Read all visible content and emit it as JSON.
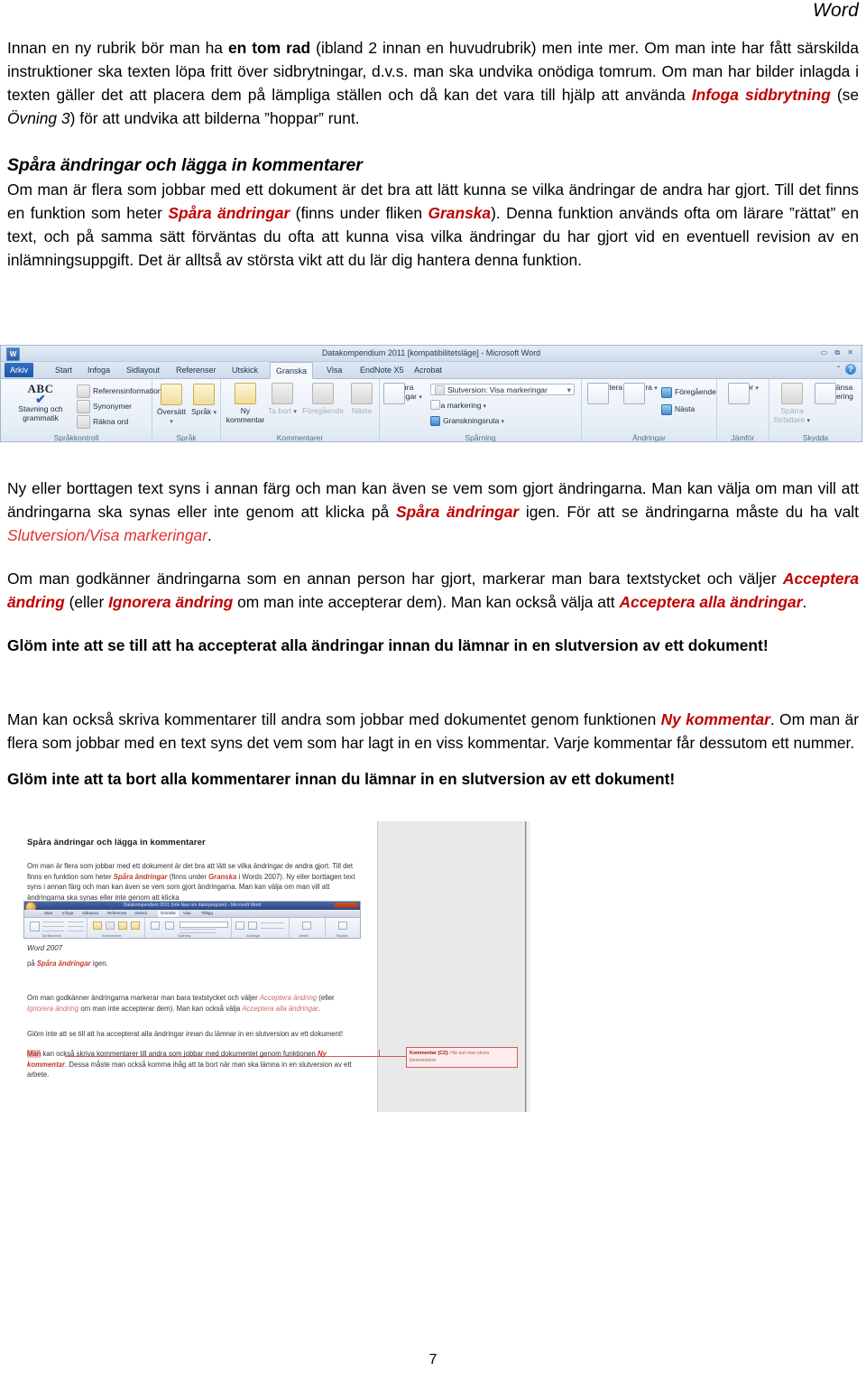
{
  "header": {
    "title": "Word"
  },
  "footer": {
    "page_number": "7"
  },
  "content": {
    "para1": {
      "seg1": "Innan en ny rubrik bör man ha ",
      "bold1": "en tom rad",
      "seg2": " (ibland 2 innan en huvudrubrik) men inte mer. Om man inte har fått särskilda instruktioner ska texten löpa fritt över sidbrytningar, d.v.s. man ska undvika onödiga tomrum. Om man har bilder inlagda i texten gäller det att placera dem på lämpliga ställen och då kan det vara till hjälp att använda ",
      "red1": "Infoga sidbrytning",
      "seg3": " (se ",
      "ital1": "Övning 3",
      "seg4": ") för att undvika att bilderna ”hoppar” runt."
    },
    "heading1": "Spåra ändringar och lägga in kommentarer",
    "para2": {
      "seg1": "Om man är flera som jobbar med ett dokument är det bra att lätt kunna se vilka ändringar de andra har gjort. Till det finns en funktion som heter ",
      "red1": "Spåra ändringar",
      "seg2": " (finns under fliken ",
      "red2": "Granska",
      "seg3": "). Denna funktion används ofta om lärare ”rättat” en text, och på samma sätt förväntas du ofta att kunna visa vilka ändringar du har gjort vid en eventuell revision av en inlämningsuppgift. Det är alltså av största vikt att du lär dig hantera denna funktion."
    },
    "para3": {
      "seg1": "Ny eller borttagen text syns i annan färg och man kan även se vem som gjort ändringarna. Man kan välja om man vill att ändringarna ska synas eller inte genom att klicka på ",
      "red1": "Spåra ändringar",
      "seg2": " igen. För att se ändringarna måste du ha valt ",
      "redi1": "Slutversion/Visa markeringar",
      "seg3": "."
    },
    "para4": {
      "seg1": "Om man godkänner ändringarna som en annan person har gjort, markerar man bara textstycket och väljer ",
      "red1": "Acceptera ändring",
      "seg2": " (eller ",
      "red2": "Ignorera ändring",
      "seg3": " om man inte accepterar dem). Man kan också välja att ",
      "red3": "Acceptera alla ändringar",
      "seg4": "."
    },
    "para5_bold": "Glöm inte att se till att ha accepterat alla ändringar innan du lämnar in en slutversion av ett dokument!",
    "para6": {
      "seg1": "Man kan också skriva kommentarer till andra som jobbar med dokumentet genom funktionen ",
      "red1": "Ny kommentar",
      "seg2": ". Om man är flera som jobbar med en text syns det vem som har lagt in en viss kommentar. Varje kommentar får dessutom ett nummer."
    },
    "para7_bold": "Glöm inte att ta bort alla kommentarer innan du lämnar in en slutversion av ett dokument!"
  },
  "ribbon_screenshot": {
    "title": "Datakompendium 2011 [kompatibilitetsläge]  -  Microsoft Word",
    "window_buttons": "▭ ⧉ ✕",
    "app_icon_label": "W",
    "tabs": [
      {
        "label": "Arkiv",
        "state": "file"
      },
      {
        "label": "Start",
        "state": "normal"
      },
      {
        "label": "Infoga",
        "state": "normal"
      },
      {
        "label": "Sidlayout",
        "state": "normal"
      },
      {
        "label": "Referenser",
        "state": "normal"
      },
      {
        "label": "Utskick",
        "state": "normal"
      },
      {
        "label": "Granska",
        "state": "active"
      },
      {
        "label": "Visa",
        "state": "normal"
      },
      {
        "label": "EndNote X5",
        "state": "normal"
      },
      {
        "label": "Acrobat",
        "state": "normal"
      }
    ],
    "groups": [
      {
        "label": "Språkkontroll",
        "big_button": "Stavning och grammatik",
        "items": [
          "Referensinformation",
          "Synonymer",
          "Räkna ord"
        ]
      },
      {
        "label": "Språk",
        "buttons": [
          "Översätt",
          "Språk"
        ]
      },
      {
        "label": "Kommentarer",
        "buttons": [
          "Ny kommentar",
          "Ta bort",
          "Föregående",
          "Nästa"
        ]
      },
      {
        "label": "Spårning",
        "big_button": "Spåra ändringar",
        "combo_value": "Slutversion: Visa markeringar",
        "items": [
          "Visa markering",
          "Granskningsruta"
        ]
      },
      {
        "label": "Ändringar",
        "buttons": [
          "Acceptera",
          "Ignorera"
        ],
        "items": [
          "Föregående",
          "Nästa"
        ]
      },
      {
        "label": "Jämför",
        "buttons": [
          "Jämför"
        ]
      },
      {
        "label": "Skydda",
        "buttons": [
          "Spärra författare",
          "Begränsa redigering"
        ]
      }
    ]
  },
  "doc_screenshot": {
    "heading": "Spåra ändringar och lägga in kommentarer",
    "para1": {
      "seg1": "Om man är flera som jobbar med ett dokument är det bra att lätt se vilka ändringar de andra gjort. Till det finns en funktion som heter ",
      "red1": "Spåra ändringar",
      "seg2": " (finns under ",
      "red2": "Granska",
      "seg3": " i Words 2007). Ny eller borttagen text syns i annan färg och man kan även se vem som gjort ändringarna. Man kan välja om man vill att ändringarna ska synas eller inte genom att klicka"
    },
    "caption": "Word 2007",
    "para2": {
      "seg1": "på ",
      "red1": "Spåra ändringar",
      "seg2": " igen."
    },
    "para3": {
      "seg1": "Om man godkänner ändringarna markerar man bara textstycket och väljer ",
      "redi1": "Acceptera ändring",
      "seg2": " (eller ",
      "redi2": "Ignorera ändring",
      "seg3": " om man inte accepterar dem). Man kan också välja ",
      "redi3": "Acceptera alla ändringar",
      "seg4": "."
    },
    "para4": "Glöm inte att se till att ha accepterat alla ändringar innan du lämnar in en slutversion av ett dokument!",
    "para5": {
      "highlight": "Man",
      "seg1": " kan också skriva kommentarer till andra som jobbar med dokumentet genom funktionen ",
      "red1": "Ny kommentar",
      "seg2": ". Dessa måste man också komma ihåg att ta bort när man ska lämna in en slutversion av ett arbete."
    },
    "comment_balloon": {
      "label": "Kommentar [C2]:",
      "text": " Här kan man skriva kommentarer"
    },
    "embedded_ribbon": {
      "title": "Datakompendium 2011 (Inte läsa om datorprogram) - Microsoft Word",
      "tabs": [
        "Start",
        "Infoga",
        "Sidlayout",
        "Referenser",
        "Utskick",
        "Granska",
        "Visa",
        "Tillägg"
      ],
      "groups": [
        "Språkkontroll",
        "Kommentarer",
        "Spårning",
        "Ändringar",
        "Jämför",
        "Skydda"
      ]
    }
  },
  "colors": {
    "accent_red": "#c00000",
    "light_red": "#e03030",
    "ribbon_blue": "#1e57a8"
  }
}
